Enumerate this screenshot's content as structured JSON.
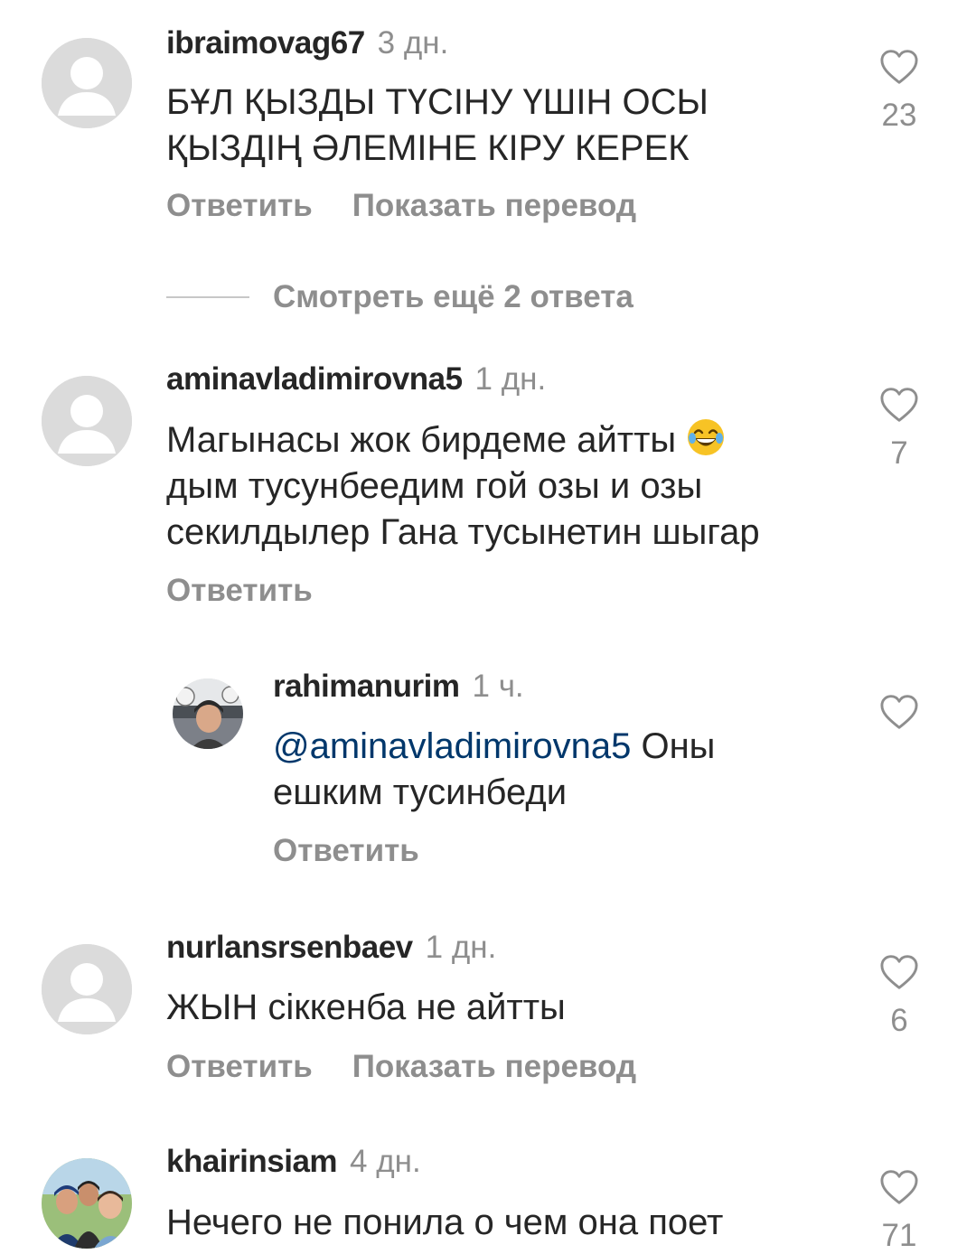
{
  "comments": [
    {
      "username": "ibraimovag67",
      "time": "3 дн.",
      "lines": [
        "БҰЛ ҚЫЗДЫ ТҮСІНУ ҮШІН ОСЫ",
        "ҚЫЗДІҢ ӘЛЕМІНЕ КІРУ КЕРЕК"
      ],
      "reply_label": "Ответить",
      "translate_label": "Показать перевод",
      "likes": "23",
      "avatar": "default-avatar-icon"
    },
    {
      "username": "aminavladimirovna5",
      "time": "1 дн.",
      "lines": [
        "Магынасы жок бирдеме айтты",
        "дым тусунбеедим гой озы и озы",
        "секилдылер Гана тусынетин шыгар"
      ],
      "emoji": "😂",
      "reply_label": "Ответить",
      "likes": "7",
      "avatar": "default-avatar-icon"
    },
    {
      "username": "rahimanurim",
      "time": "1 ч.",
      "mention": "@aminavladimirovna5",
      "lines": [
        "Оны",
        "ешким тусинбеди"
      ],
      "reply_label": "Ответить",
      "avatar": "photo-avatar"
    },
    {
      "username": "nurlansrsenbaev",
      "time": "1 дн.",
      "lines": [
        "ЖЫН сіккенба не айтты"
      ],
      "reply_label": "Ответить",
      "translate_label": "Показать перевод",
      "likes": "6",
      "avatar": "default-avatar-icon"
    },
    {
      "username": "khairinsiam",
      "time": "4 дн.",
      "lines": [
        "Нечего не понила о чем она поет"
      ],
      "likes": "71",
      "avatar": "photo-avatar"
    }
  ],
  "view_more": "Смотреть ещё 2 ответа",
  "colors": {
    "text": "#262626",
    "secondary": "#8e8e8e",
    "mention": "#00376b",
    "avatar_bg": "#dbdbdb"
  }
}
